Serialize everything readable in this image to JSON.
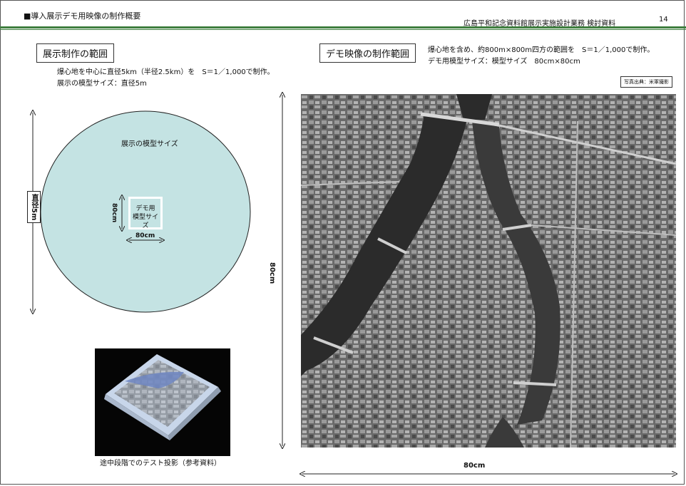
{
  "header": {
    "title": "■導入展示デモ用映像の制作概要",
    "subtitle": "広島平和記念資料館展示実施設計業務 検討資料",
    "page_number": "14"
  },
  "left": {
    "section_label": "展示制作の範囲",
    "line1": "爆心地を中心に直径5km（半径2.5km）を　S＝1／1,000で制作。",
    "line2": "展示の模型サイズ：直径5m",
    "circle_label": "展示の模型サイズ",
    "diameter_label": "直径5m",
    "demo_label_1": "デモ用",
    "demo_label_2": "模型サイズ",
    "demo_width": "80cm",
    "demo_height": "80cm",
    "photo_caption": "途中段階でのテスト投影（参考資料）",
    "circle_color": "#c4e3e3"
  },
  "right": {
    "section_label": "デモ映像の制作範囲",
    "line1": "爆心地を含め、約800m×800m四方の範囲を　S＝1／1,000で制作。",
    "line2": "デモ用模型サイズ：模型サイズ　80cm×80cm",
    "photo_credit": "写真出典：米軍撮影",
    "width_label": "80cm",
    "height_label": "80cm"
  },
  "colors": {
    "header_line": "#3f7f3f"
  }
}
